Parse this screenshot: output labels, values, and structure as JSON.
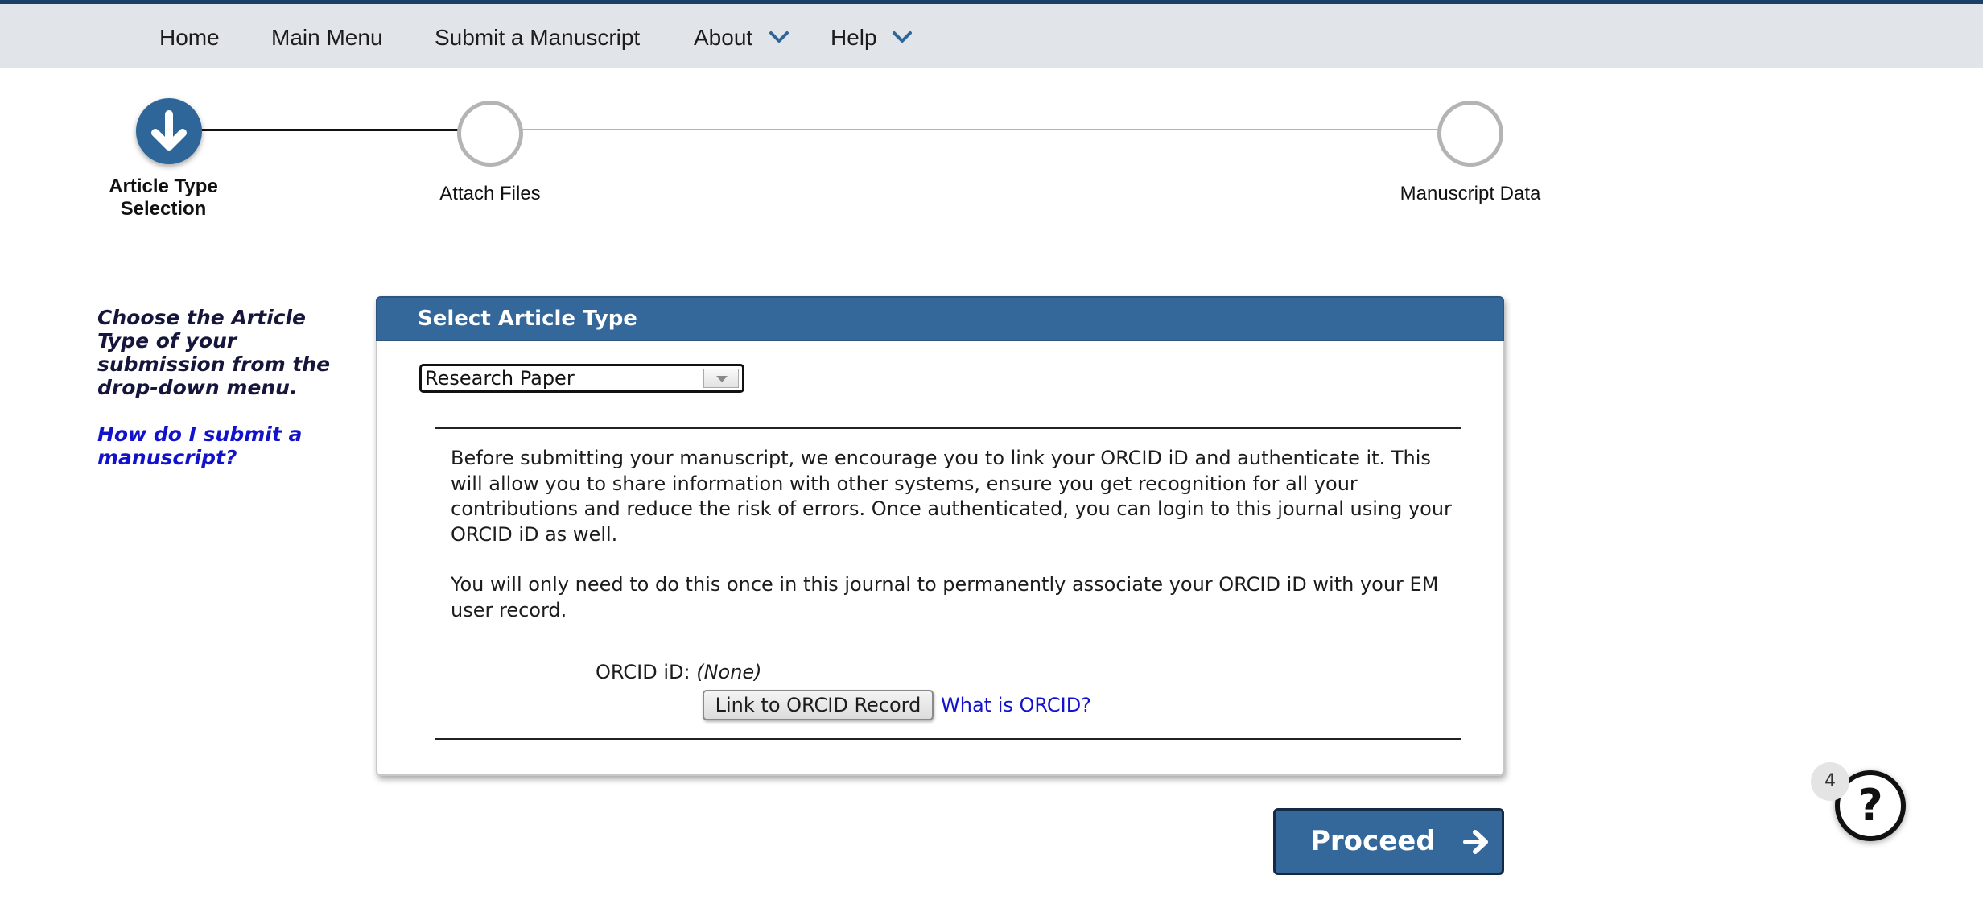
{
  "nav": {
    "items": [
      {
        "label": "Home"
      },
      {
        "label": "Main Menu"
      },
      {
        "label": "Submit a Manuscript"
      },
      {
        "label": "About",
        "has_dropdown": true
      },
      {
        "label": "Help",
        "has_dropdown": true
      }
    ]
  },
  "stepper": {
    "steps": [
      {
        "label": "Article Type Selection",
        "state": "current",
        "icon": "arrow-down-icon"
      },
      {
        "label": "Attach Files",
        "state": "pending"
      },
      {
        "label": "Manuscript Data",
        "state": "pending"
      }
    ]
  },
  "instructions": {
    "text": "Choose the Article Type of your submission from the drop-down menu.",
    "help_link": "How do I submit a manuscript?"
  },
  "panel": {
    "title": "Select Article Type",
    "article_type_select": {
      "selected": "Research Paper"
    },
    "orcid": {
      "paragraph1": "Before submitting your manuscript, we encourage you to link your ORCID iD and authenticate it. This will allow you to share information with other systems, ensure you get recognition for all your contributions and reduce the risk of errors. Once authenticated, you can login to this journal using your ORCID iD as well.",
      "paragraph2": "You will only need to do this once in this journal to permanently associate your ORCID iD with your EM user record.",
      "label": "ORCID iD:",
      "value": "(None)",
      "link_button": "Link to ORCID Record",
      "what_is_link": "What is ORCID?"
    }
  },
  "proceed": {
    "label": "Proceed",
    "icon": "arrow-right-icon"
  },
  "help_widget": {
    "badge": "4",
    "glyph": "?",
    "icon": "help-icon"
  },
  "colors": {
    "brand_blue": "#34679a",
    "nav_border": "#1b3f66",
    "nav_background": "#e1e4e8",
    "link_blue": "#1212cc",
    "step_inactive": "#b4b4b4"
  }
}
